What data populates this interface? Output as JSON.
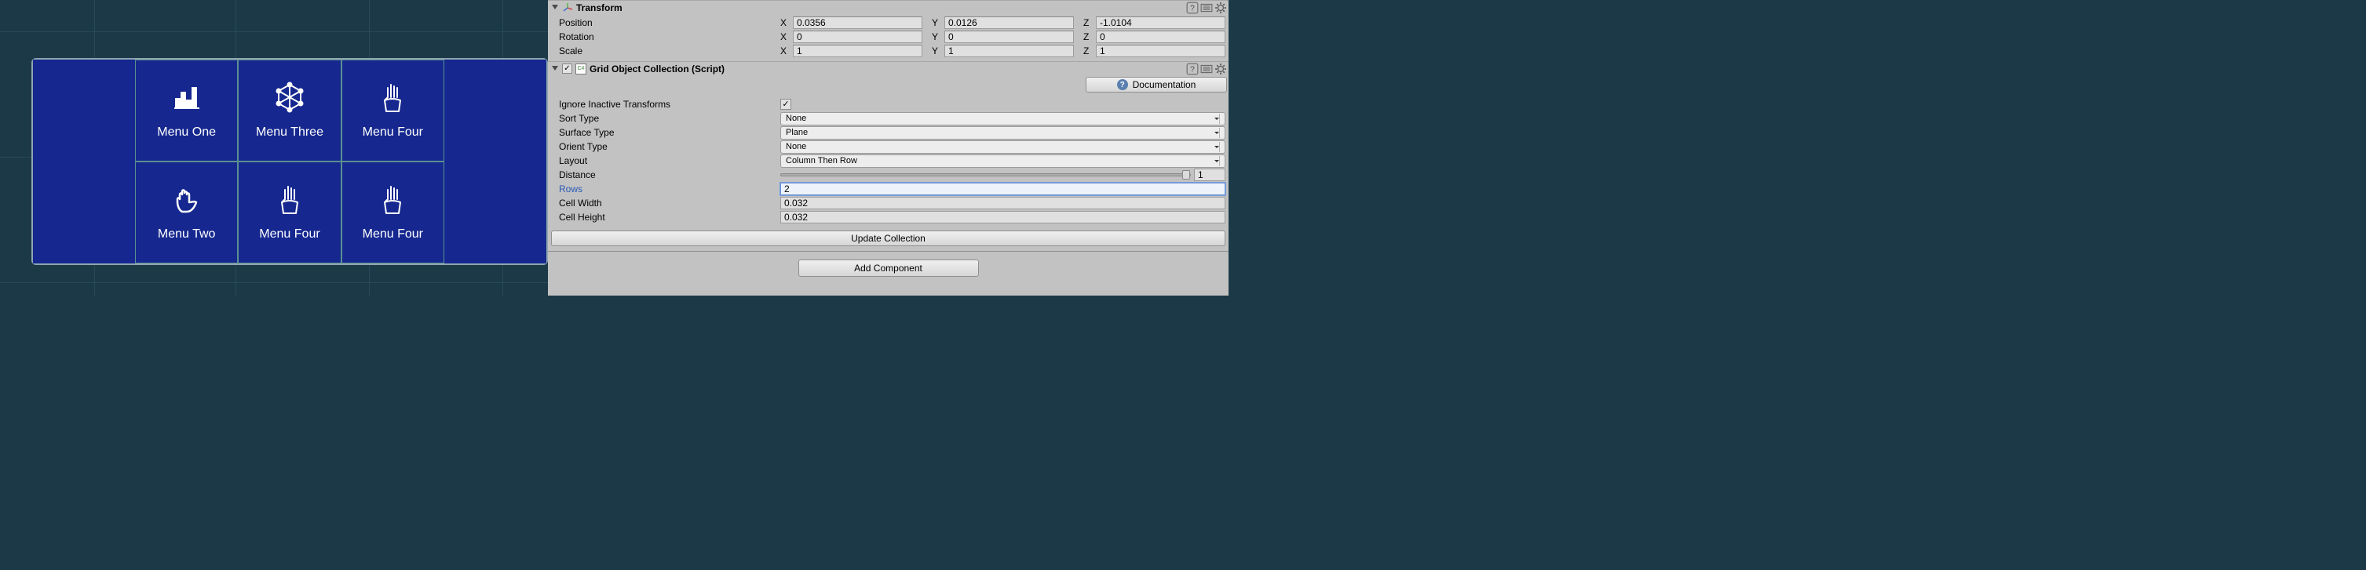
{
  "scene": {
    "menu_items": [
      {
        "label": "Menu One",
        "icon": "bars-icon"
      },
      {
        "label": "Menu Three",
        "icon": "box3d-icon"
      },
      {
        "label": "Menu Four",
        "icon": "hand-up-icon"
      },
      {
        "label": "Menu Two",
        "icon": "hand-stop-icon"
      },
      {
        "label": "Menu Four",
        "icon": "hand-up-icon"
      },
      {
        "label": "Menu Four",
        "icon": "hand-up-icon"
      }
    ],
    "pin_name": "pin-icon"
  },
  "inspector": {
    "transform": {
      "title": "Transform",
      "position": {
        "label": "Position",
        "x": "0.0356",
        "y": "0.0126",
        "z": "-1.0104"
      },
      "rotation": {
        "label": "Rotation",
        "x": "0",
        "y": "0",
        "z": "0"
      },
      "scale": {
        "label": "Scale",
        "x": "1",
        "y": "1",
        "z": "1"
      },
      "axis_x": "X",
      "axis_y": "Y",
      "axis_z": "Z"
    },
    "grid": {
      "title": "Grid Object Collection (Script)",
      "doc_button": "Documentation",
      "ignore_inactive": {
        "label": "Ignore Inactive Transforms",
        "checked": true
      },
      "sort_type": {
        "label": "Sort Type",
        "value": "None"
      },
      "surface_type": {
        "label": "Surface Type",
        "value": "Plane"
      },
      "orient_type": {
        "label": "Orient Type",
        "value": "None"
      },
      "layout": {
        "label": "Layout",
        "value": "Column Then Row"
      },
      "distance": {
        "label": "Distance",
        "value": "1",
        "thumb_pct": 100
      },
      "rows": {
        "label": "Rows",
        "value": "2"
      },
      "cell_width": {
        "label": "Cell Width",
        "value": "0.032"
      },
      "cell_height": {
        "label": "Cell Height",
        "value": "0.032"
      },
      "update_button": "Update Collection"
    },
    "add_component": "Add Component"
  }
}
